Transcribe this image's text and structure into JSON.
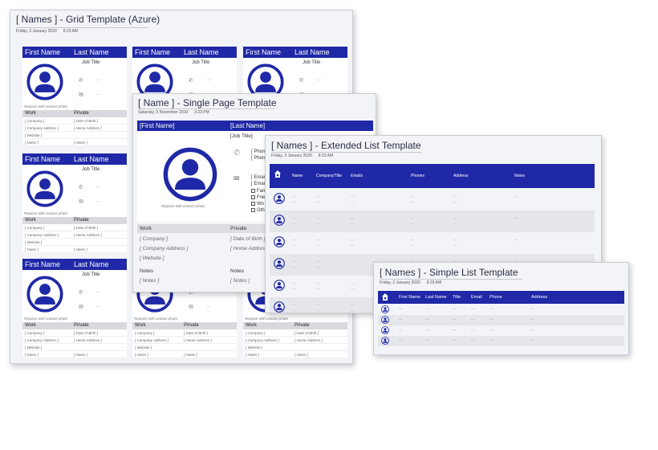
{
  "grid_page": {
    "title": "[ Names ] - Grid Template (Azure)",
    "date": "Friday, 3 January 2020",
    "time": "8:23 AM",
    "cards": [
      {
        "first_name": "First Name",
        "last_name": "Last Name",
        "job_title": "Job Title",
        "phone": "...",
        "email": "...",
        "photo_caption": "Replace with contact photo",
        "work_label": "Work",
        "private_label": "Private",
        "company": "[ Company ]",
        "dob": "[ Date of Birth ]",
        "company_address": "[ Company  Address ]",
        "home_address": "[ Home Address ]",
        "website": "[ Website ]",
        "notes": "[ Notes ]",
        "notes_private": "[ Notes ]"
      },
      {
        "first_name": "First Name",
        "last_name": "Last Name",
        "job_title": "Job Title",
        "phone": "...",
        "email": "...",
        "photo_caption": "Replace with contact photo",
        "work_label": "Work",
        "private_label": "Private",
        "company": "[ Company ]",
        "dob": "[ Date of Birth ]",
        "company_address": "[ Company  Address ]",
        "home_address": "[ Home Address ]",
        "website": "[ Website ]",
        "notes": "[ Notes ]",
        "notes_private": "[ Notes ]"
      },
      {
        "first_name": "First Name",
        "last_name": "Last Name",
        "job_title": "Job Title",
        "phone": "...",
        "email": "...",
        "photo_caption": "Replace with contact photo",
        "work_label": "Work",
        "private_label": "Private",
        "company": "[ Company ]",
        "dob": "[ Date of Birth ]",
        "company_address": "[ Company  Address ]",
        "home_address": "[ Home Address ]",
        "website": "[ Website ]",
        "notes": "[ Notes ]",
        "notes_private": "[ Notes ]"
      },
      {
        "first_name": "First Name",
        "last_name": "Last Name",
        "job_title": "Job Title",
        "phone": "...",
        "email": "...",
        "photo_caption": "Replace with contact photo",
        "work_label": "Work",
        "private_label": "Private",
        "company": "[ Company ]",
        "dob": "[ Date of Birth ]",
        "company_address": "[ Company  Address ]",
        "home_address": "[ Home Address ]",
        "website": "[ Website ]",
        "notes": "[ Notes ]",
        "notes_private": "[ Notes ]"
      },
      {
        "first_name": "First Name",
        "last_name": "Last Name",
        "job_title": "Job Title",
        "phone": "...",
        "email": "...",
        "photo_caption": "Replace with contact photo",
        "work_label": "Work",
        "private_label": "Private",
        "company": "[ Company ]",
        "dob": "[ Date of Birth ]",
        "company_address": "[ Company  Address ]",
        "home_address": "[ Home Address ]",
        "website": "[ Website ]",
        "notes": "[ Notes ]",
        "notes_private": "[ Notes ]"
      },
      {
        "first_name": "First Name",
        "last_name": "Last Name",
        "job_title": "Job Title",
        "phone": "...",
        "email": "...",
        "photo_caption": "Replace with contact photo",
        "work_label": "Work",
        "private_label": "Private",
        "company": "[ Company ]",
        "dob": "[ Date of Birth ]",
        "company_address": "[ Company  Address ]",
        "home_address": "[ Home Address ]",
        "website": "[ Website ]",
        "notes": "[ Notes ]",
        "notes_private": "[ Notes ]"
      },
      {
        "first_name": "First Name",
        "last_name": "Last Name",
        "job_title": "Job Title",
        "phone": "...",
        "email": "...",
        "photo_caption": "Replace with contact photo",
        "work_label": "Work",
        "private_label": "Private",
        "company": "[ Company ]",
        "dob": "[ Date of Birth ]",
        "company_address": "[ Company  Address ]",
        "home_address": "[ Home Address ]",
        "website": "[ Website ]",
        "notes": "[ Notes ]",
        "notes_private": "[ Notes ]"
      }
    ]
  },
  "single_page": {
    "title": "[ Name ] - Single Page Template",
    "date": "Saturday, 9 November 2019",
    "time": "3:23 PM",
    "first_name": "[First Name]",
    "last_name": "[Last Name]",
    "job_title": "[Job Title]",
    "phone_lines": [
      "[ Phon",
      "[ Phon"
    ],
    "email_lines": [
      "[ Emai",
      "[ Emai"
    ],
    "checkboxes": [
      "Fam",
      "Frie",
      "Wo",
      "Oth"
    ],
    "photo_caption": "Replace with contact photo",
    "work_label": "Work",
    "private_label": "Private",
    "company": "[ Company ]",
    "dob": "[ Date of Birth ]",
    "company_address": "[ Company  Address ]",
    "home_address": "[ Home Address",
    "website": "[ Website ]",
    "notes_label_work": "Notes",
    "notes_label_private": "Notes",
    "notes_work": "[ Notes ]",
    "notes_private": "[ Notes ]"
  },
  "extended_page": {
    "title": "[ Names ] - Extended List Template",
    "date": "Friday, 3 January 2020",
    "time": "8:23 AM",
    "columns": [
      "Name",
      "Company/Title",
      "Emails",
      "Phones",
      "Address",
      "Notes"
    ],
    "cell_placeholder": "..."
  },
  "simple_page": {
    "title": "[ Names ] - Simple List Template",
    "date": "Friday, 3 January 2020",
    "time": "8:23 AM",
    "columns": [
      "First Name",
      "Last Name",
      "Title",
      "Email",
      "Phone",
      "Address"
    ],
    "cell_placeholder": "..."
  },
  "colors": {
    "header_blue": "#1f28a6",
    "avatar_blue": "#1f28a6"
  },
  "icons": [
    "person-avatar-icon",
    "phone-icon",
    "mail-icon",
    "house-icon",
    "checkbox-icon"
  ]
}
